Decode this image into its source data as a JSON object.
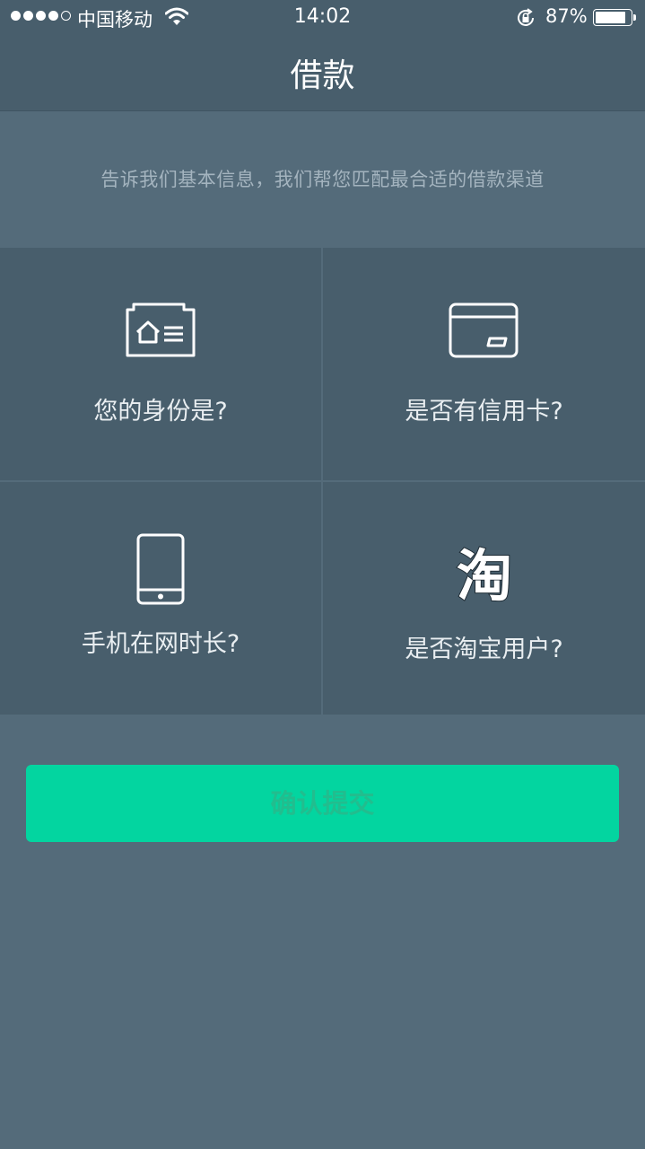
{
  "status_bar": {
    "carrier": "中国移动",
    "time": "14:02",
    "battery_percent": "87%",
    "battery_level": 0.87,
    "signal_bars": 4,
    "signal_total": 5
  },
  "nav": {
    "title": "借款"
  },
  "intro": {
    "text": "告诉我们基本信息，我们帮您匹配最合适的借款渠道"
  },
  "options": [
    {
      "label": "您的身份是?",
      "icon": "id-card-icon"
    },
    {
      "label": "是否有信用卡?",
      "icon": "credit-card-icon"
    },
    {
      "label": "手机在网时长?",
      "icon": "mobile-phone-icon"
    },
    {
      "label": "是否淘宝用户?",
      "icon": "taobao-icon",
      "icon_text": "淘"
    }
  ],
  "submit": {
    "label": "确认提交"
  },
  "colors": {
    "background": "#546b7a",
    "panel": "#485e6c",
    "accent": "#03d5a0",
    "intro_text": "#a4b4bf"
  }
}
